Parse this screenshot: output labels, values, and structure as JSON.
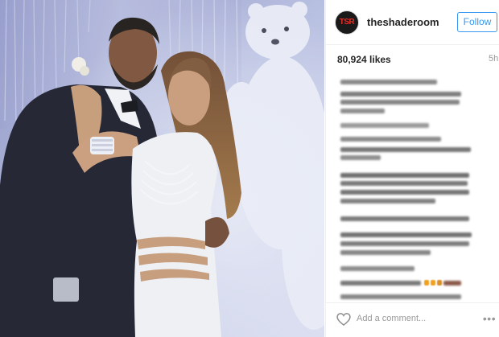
{
  "post": {
    "username": "theshaderoom",
    "follow_label": "Follow",
    "likes": "80,924 likes",
    "time": "5h",
    "comment_placeholder": "Add a comment...",
    "icons": {
      "avatar_logo": "theshaderoom-logo",
      "like": "heart-icon",
      "more": "more-options-icon"
    },
    "colors": {
      "accent": "#3897f0",
      "text": "#262626",
      "muted": "#999999",
      "divider": "#efefef"
    }
  }
}
